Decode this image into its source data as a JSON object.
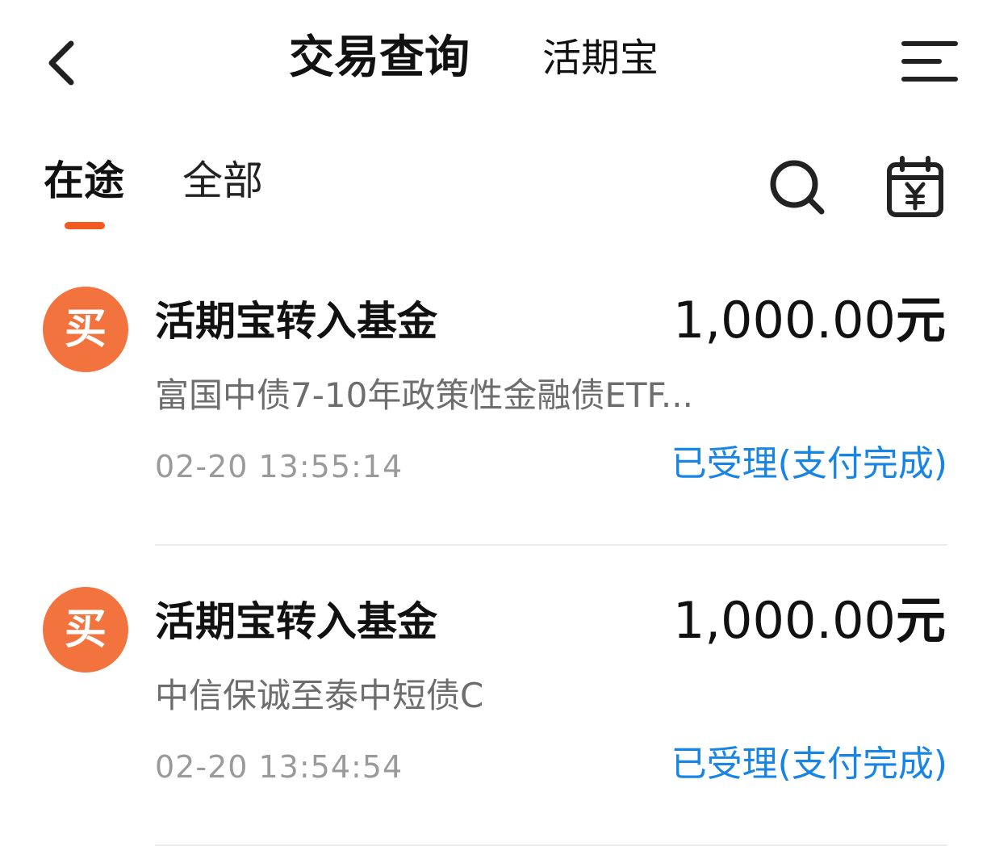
{
  "header": {
    "back_icon": "chevron-left-icon",
    "title": "交易查询",
    "subtitle": "活期宝",
    "menu_icon": "menu-icon"
  },
  "tabs": [
    {
      "label": "在途",
      "active": true
    },
    {
      "label": "全部",
      "active": false
    }
  ],
  "toolbar": {
    "search_icon": "search-icon",
    "calendar_icon": "calendar-yuan-icon"
  },
  "colors": {
    "accent": "#f25a1f",
    "badge": "#f3733f",
    "status": "#1784e6"
  },
  "transactions": [
    {
      "badge": "买",
      "title": "活期宝转入基金",
      "amount": "1,000.00",
      "unit": "元",
      "fund": "富国中债7-10年政策性金融债ETF...",
      "time": "02-20 13:55:14",
      "status": "已受理(支付完成)"
    },
    {
      "badge": "买",
      "title": "活期宝转入基金",
      "amount": "1,000.00",
      "unit": "元",
      "fund": "中信保诚至泰中短债C",
      "time": "02-20 13:54:54",
      "status": "已受理(支付完成)"
    }
  ]
}
